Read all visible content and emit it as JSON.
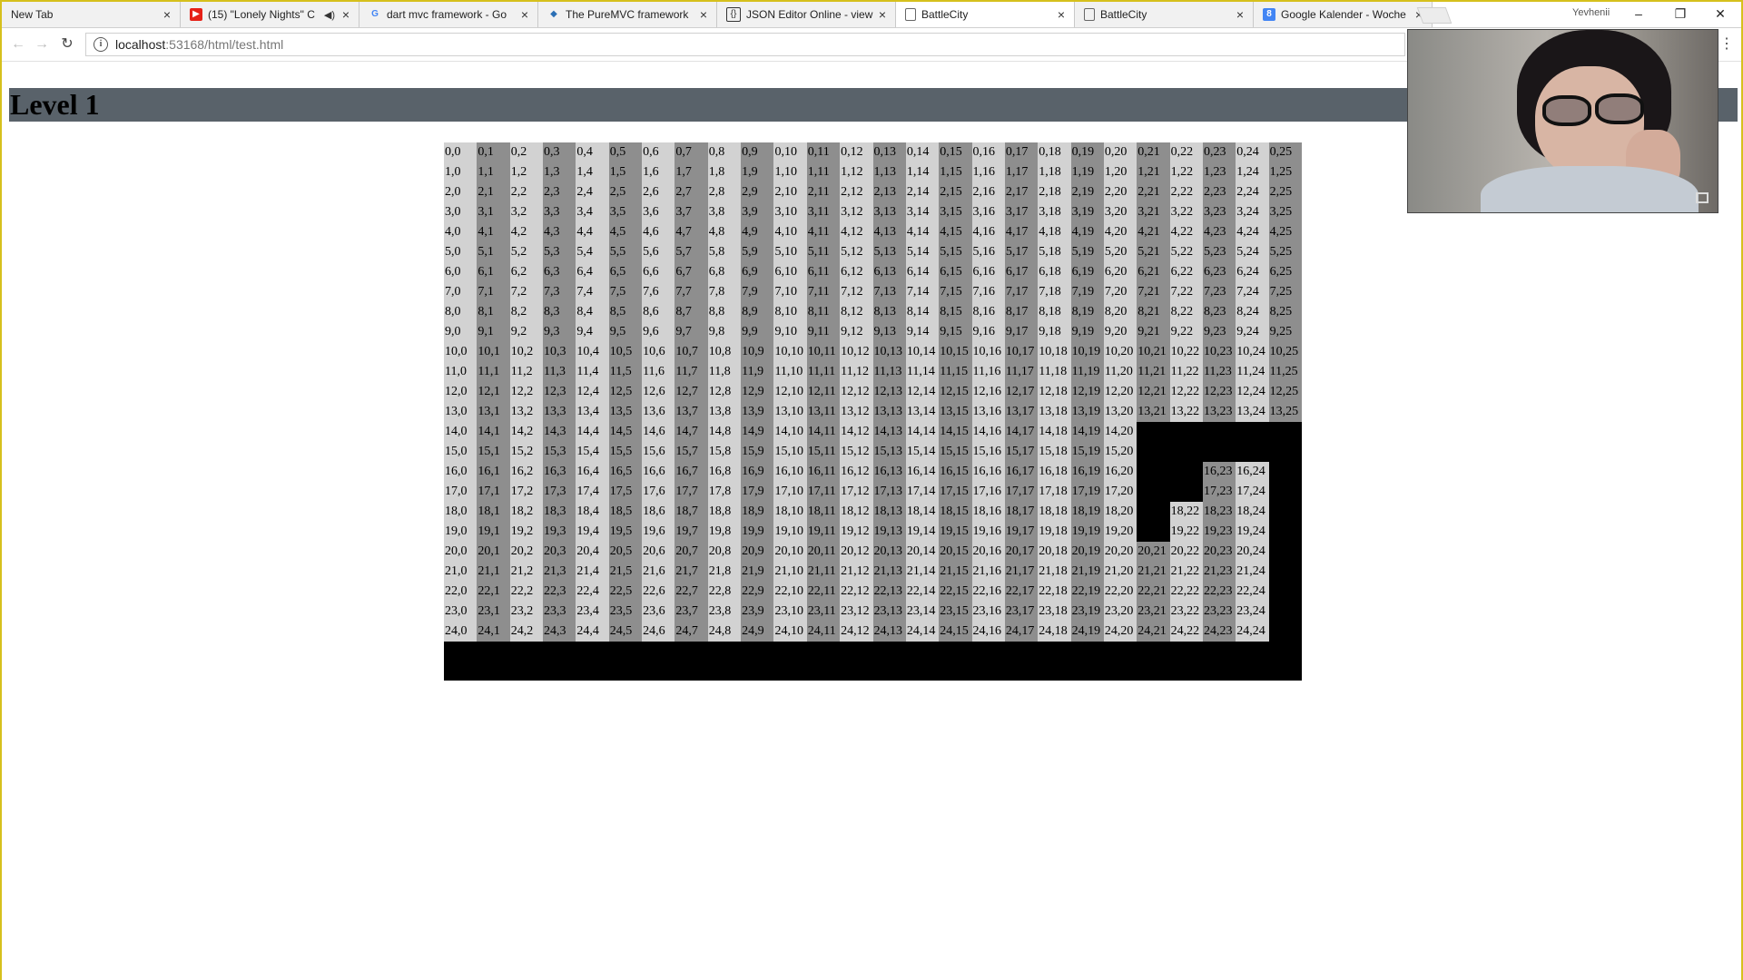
{
  "browser": {
    "tabs": [
      {
        "title": "New Tab",
        "icon": "none",
        "active": false
      },
      {
        "title": "(15) \"Lonely Nights\" C",
        "icon": "youtube-icon",
        "active": false,
        "audio": true
      },
      {
        "title": "dart mvc framework - Go",
        "icon": "google-icon",
        "active": false
      },
      {
        "title": "The PureMVC framework",
        "icon": "puremvc-icon",
        "active": false
      },
      {
        "title": "JSON Editor Online - view",
        "icon": "json-icon",
        "active": false
      },
      {
        "title": "BattleCity",
        "icon": "page-icon",
        "active": true
      },
      {
        "title": "BattleCity",
        "icon": "page-icon",
        "active": false
      },
      {
        "title": "Google Kalender - Woche",
        "icon": "calendar-icon",
        "active": false
      }
    ],
    "tab_close_glyph": "×",
    "audio_glyph": "◀)",
    "profile_name": "Yevhenii",
    "window_controls": {
      "minimize": "–",
      "restore": "❐",
      "close": "✕"
    },
    "nav": {
      "back": "←",
      "forward": "→",
      "reload": "↻",
      "menu": "⋮"
    },
    "url_host": "localhost",
    "url_path": ":53168/html/test.html",
    "info_glyph": "i",
    "calendar_glyph": "8",
    "google_glyph": "G",
    "json_glyph": "{}"
  },
  "page": {
    "header_color": "#59626a",
    "level_title": "Level 1"
  },
  "board": {
    "rows": 25,
    "cols": 26,
    "label_separator": ",",
    "light_color": "#d2d2d2",
    "dark_color": "#8e8e8e",
    "black_cells": {
      "14": [
        21,
        22,
        23,
        24,
        25
      ],
      "15": [
        21,
        22,
        23,
        24,
        25
      ],
      "16": [
        21,
        22,
        25
      ],
      "17": [
        21,
        22,
        25
      ],
      "18": [
        21,
        25
      ],
      "19": [
        21,
        25
      ],
      "20": [
        25
      ],
      "21": [
        25
      ],
      "22": [
        25
      ],
      "23": [
        25
      ],
      "24": [
        25
      ]
    }
  }
}
